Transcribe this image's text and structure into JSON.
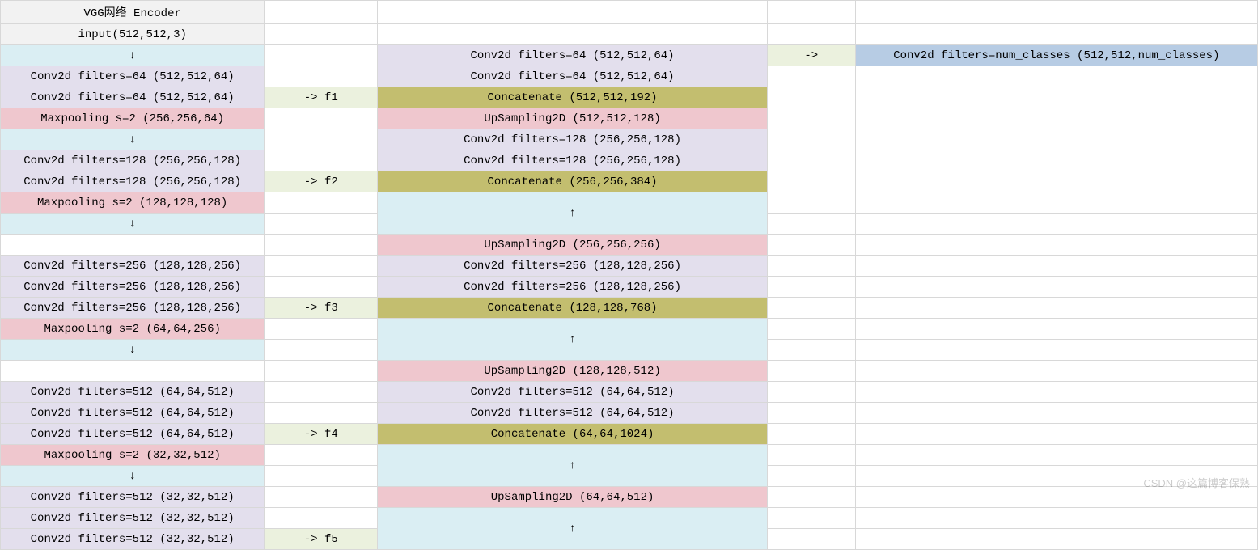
{
  "rows": [
    {
      "a": {
        "t": "VGG网络 Encoder",
        "c": "bg-gray"
      },
      "b": {
        "t": "",
        "c": ""
      },
      "c": {
        "t": "",
        "c": ""
      },
      "d": {
        "t": "",
        "c": ""
      },
      "e": {
        "t": "",
        "c": ""
      }
    },
    {
      "a": {
        "t": "input(512,512,3)",
        "c": "bg-gray"
      },
      "b": {
        "t": "",
        "c": ""
      },
      "c": {
        "t": "",
        "c": ""
      },
      "d": {
        "t": "",
        "c": ""
      },
      "e": {
        "t": "",
        "c": ""
      }
    },
    {
      "a": {
        "t": "↓",
        "c": "bg-cyan"
      },
      "b": {
        "t": "",
        "c": ""
      },
      "c": {
        "t": "Conv2d filters=64 (512,512,64)",
        "c": "bg-purple"
      },
      "d": {
        "t": "->",
        "c": "bg-green"
      },
      "e": {
        "t": "Conv2d filters=num_classes (512,512,num_classes)",
        "c": "bg-blue"
      }
    },
    {
      "a": {
        "t": "Conv2d filters=64 (512,512,64)",
        "c": "bg-purple"
      },
      "b": {
        "t": "",
        "c": ""
      },
      "c": {
        "t": "Conv2d filters=64 (512,512,64)",
        "c": "bg-purple"
      },
      "d": {
        "t": "",
        "c": ""
      },
      "e": {
        "t": "",
        "c": ""
      }
    },
    {
      "a": {
        "t": "Conv2d filters=64 (512,512,64)",
        "c": "bg-purple"
      },
      "b": {
        "t": "-> f1",
        "c": "bg-green"
      },
      "c": {
        "t": "Concatenate (512,512,192)",
        "c": "bg-olive"
      },
      "d": {
        "t": "",
        "c": ""
      },
      "e": {
        "t": "",
        "c": ""
      }
    },
    {
      "a": {
        "t": "Maxpooling s=2 (256,256,64)",
        "c": "bg-pink"
      },
      "b": {
        "t": "",
        "c": ""
      },
      "c": {
        "t": "UpSampling2D (512,512,128)",
        "c": "bg-pink"
      },
      "d": {
        "t": "",
        "c": ""
      },
      "e": {
        "t": "",
        "c": ""
      }
    },
    {
      "a": {
        "t": "↓",
        "c": "bg-cyan"
      },
      "b": {
        "t": "",
        "c": ""
      },
      "c": {
        "t": "Conv2d filters=128 (256,256,128)",
        "c": "bg-purple"
      },
      "d": {
        "t": "",
        "c": ""
      },
      "e": {
        "t": "",
        "c": ""
      }
    },
    {
      "a": {
        "t": "Conv2d filters=128 (256,256,128)",
        "c": "bg-purple"
      },
      "b": {
        "t": "",
        "c": ""
      },
      "c": {
        "t": "Conv2d filters=128 (256,256,128)",
        "c": "bg-purple"
      },
      "d": {
        "t": "",
        "c": ""
      },
      "e": {
        "t": "",
        "c": ""
      }
    },
    {
      "a": {
        "t": "Conv2d filters=128 (256,256,128)",
        "c": "bg-purple"
      },
      "b": {
        "t": "-> f2",
        "c": "bg-green"
      },
      "c": {
        "t": "Concatenate (256,256,384)",
        "c": "bg-olive"
      },
      "d": {
        "t": "",
        "c": ""
      },
      "e": {
        "t": "",
        "c": ""
      }
    },
    {
      "a": {
        "t": "Maxpooling s=2 (128,128,128)",
        "c": "bg-pink"
      },
      "b": {
        "t": "",
        "c": ""
      },
      "c": {
        "t": "↑",
        "c": "bg-cyan",
        "rs": 2
      },
      "d": {
        "t": "",
        "c": ""
      },
      "e": {
        "t": "",
        "c": ""
      }
    },
    {
      "a": {
        "t": "↓",
        "c": "bg-cyan"
      },
      "b": {
        "t": "",
        "c": ""
      },
      "c": null,
      "d": {
        "t": "",
        "c": ""
      },
      "e": {
        "t": "",
        "c": ""
      }
    },
    {
      "a": {
        "t": "",
        "c": ""
      },
      "b": {
        "t": "",
        "c": ""
      },
      "c": {
        "t": "UpSampling2D (256,256,256)",
        "c": "bg-pink"
      },
      "d": {
        "t": "",
        "c": ""
      },
      "e": {
        "t": "",
        "c": ""
      },
      "skipA": true
    },
    {
      "a": {
        "t": "Conv2d filters=256 (128,128,256)",
        "c": "bg-purple"
      },
      "b": {
        "t": "",
        "c": ""
      },
      "c": {
        "t": "Conv2d filters=256 (128,128,256)",
        "c": "bg-purple"
      },
      "d": {
        "t": "",
        "c": ""
      },
      "e": {
        "t": "",
        "c": ""
      }
    },
    {
      "a": {
        "t": "Conv2d filters=256 (128,128,256)",
        "c": "bg-purple"
      },
      "b": {
        "t": "",
        "c": ""
      },
      "c": {
        "t": "Conv2d filters=256 (128,128,256)",
        "c": "bg-purple"
      },
      "d": {
        "t": "",
        "c": ""
      },
      "e": {
        "t": "",
        "c": ""
      }
    },
    {
      "a": {
        "t": "Conv2d filters=256 (128,128,256)",
        "c": "bg-purple"
      },
      "b": {
        "t": "-> f3",
        "c": "bg-green"
      },
      "c": {
        "t": "Concatenate (128,128,768)",
        "c": "bg-olive"
      },
      "d": {
        "t": "",
        "c": ""
      },
      "e": {
        "t": "",
        "c": ""
      }
    },
    {
      "a": {
        "t": "Maxpooling s=2 (64,64,256)",
        "c": "bg-pink"
      },
      "b": {
        "t": "",
        "c": ""
      },
      "c": {
        "t": "↑",
        "c": "bg-cyan",
        "rs": 2
      },
      "d": {
        "t": "",
        "c": ""
      },
      "e": {
        "t": "",
        "c": ""
      }
    },
    {
      "a": {
        "t": "↓",
        "c": "bg-cyan"
      },
      "b": {
        "t": "",
        "c": ""
      },
      "c": null,
      "d": {
        "t": "",
        "c": ""
      },
      "e": {
        "t": "",
        "c": ""
      }
    },
    {
      "a": {
        "t": "",
        "c": ""
      },
      "b": {
        "t": "",
        "c": ""
      },
      "c": {
        "t": "UpSampling2D (128,128,512)",
        "c": "bg-pink"
      },
      "d": {
        "t": "",
        "c": ""
      },
      "e": {
        "t": "",
        "c": ""
      },
      "skipA": true
    },
    {
      "a": {
        "t": "Conv2d filters=512 (64,64,512)",
        "c": "bg-purple"
      },
      "b": {
        "t": "",
        "c": ""
      },
      "c": {
        "t": "Conv2d filters=512 (64,64,512)",
        "c": "bg-purple"
      },
      "d": {
        "t": "",
        "c": ""
      },
      "e": {
        "t": "",
        "c": ""
      }
    },
    {
      "a": {
        "t": "Conv2d filters=512 (64,64,512)",
        "c": "bg-purple"
      },
      "b": {
        "t": "",
        "c": ""
      },
      "c": {
        "t": "Conv2d filters=512 (64,64,512)",
        "c": "bg-purple"
      },
      "d": {
        "t": "",
        "c": ""
      },
      "e": {
        "t": "",
        "c": ""
      }
    },
    {
      "a": {
        "t": "Conv2d filters=512 (64,64,512)",
        "c": "bg-purple"
      },
      "b": {
        "t": "-> f4",
        "c": "bg-green"
      },
      "c": {
        "t": "Concatenate (64,64,1024)",
        "c": "bg-olive"
      },
      "d": {
        "t": "",
        "c": ""
      },
      "e": {
        "t": "",
        "c": ""
      }
    },
    {
      "a": {
        "t": "Maxpooling s=2 (32,32,512)",
        "c": "bg-pink"
      },
      "b": {
        "t": "",
        "c": ""
      },
      "c": {
        "t": "↑",
        "c": "bg-cyan",
        "rs": 2
      },
      "d": {
        "t": "",
        "c": ""
      },
      "e": {
        "t": "",
        "c": ""
      }
    },
    {
      "a": {
        "t": "↓",
        "c": "bg-cyan"
      },
      "b": {
        "t": "",
        "c": ""
      },
      "c": null,
      "d": {
        "t": "",
        "c": ""
      },
      "e": {
        "t": "",
        "c": ""
      }
    },
    {
      "a": {
        "t": "Conv2d filters=512 (32,32,512)",
        "c": "bg-purple"
      },
      "b": {
        "t": "",
        "c": ""
      },
      "c": {
        "t": "UpSampling2D (64,64,512)",
        "c": "bg-pink"
      },
      "d": {
        "t": "",
        "c": ""
      },
      "e": {
        "t": "",
        "c": ""
      }
    },
    {
      "a": {
        "t": "Conv2d filters=512 (32,32,512)",
        "c": "bg-purple"
      },
      "b": {
        "t": "",
        "c": ""
      },
      "c": {
        "t": "↑",
        "c": "bg-cyan",
        "rs": 2
      },
      "d": {
        "t": "",
        "c": ""
      },
      "e": {
        "t": "",
        "c": ""
      }
    },
    {
      "a": {
        "t": "Conv2d filters=512 (32,32,512)",
        "c": "bg-purple"
      },
      "b": {
        "t": "-> f5",
        "c": "bg-green"
      },
      "c": null,
      "d": {
        "t": "",
        "c": ""
      },
      "e": {
        "t": "",
        "c": ""
      }
    }
  ],
  "watermark": "CSDN @这篇博客保熟"
}
